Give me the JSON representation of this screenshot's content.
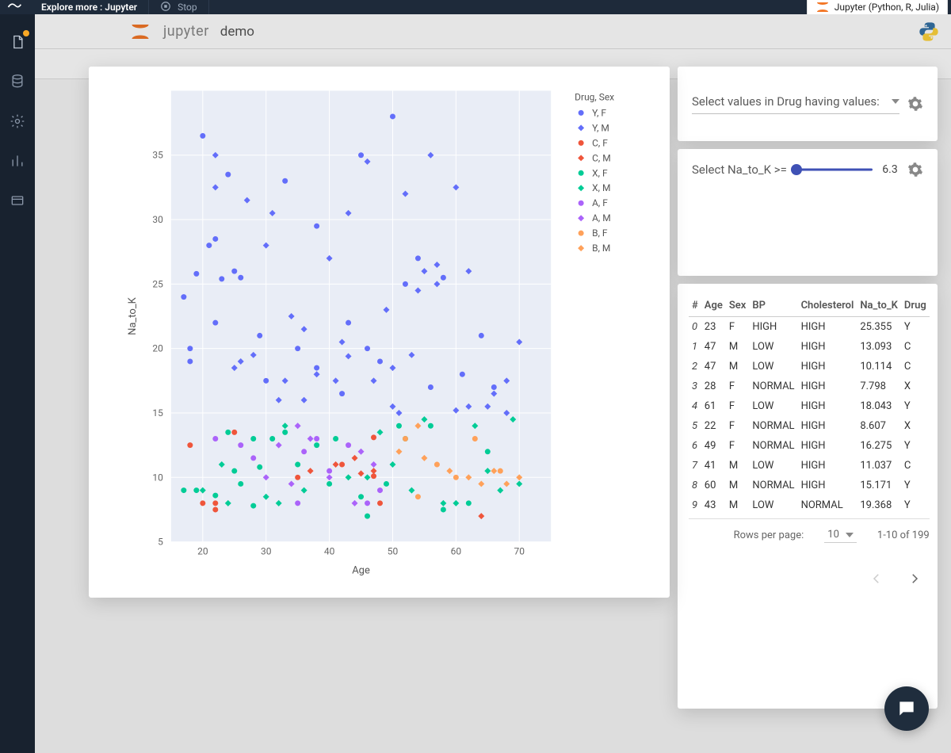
{
  "topbar": {
    "brand": "cnvrg",
    "tab_label": "Explore more : Jupyter",
    "stop_label": "Stop",
    "kernel_label": "Jupyter (Python, R, Julia)"
  },
  "sidebar_items": [
    "projects",
    "database",
    "settings",
    "analytics",
    "docs"
  ],
  "notebook": {
    "logo_text": "jupyter",
    "title": "demo"
  },
  "filter": {
    "label": "Select values in Drug having values:"
  },
  "slider": {
    "label": "Select Na_to_K >=",
    "value": "6.3",
    "min": 6.3,
    "max": 38.2,
    "pos_pct": 0
  },
  "table": {
    "columns": [
      "#",
      "Age",
      "Sex",
      "BP",
      "Cholesterol",
      "Na_to_K",
      "Drug"
    ],
    "rows": [
      {
        "i": "0",
        "Age": "23",
        "Sex": "F",
        "BP": "HIGH",
        "Chol": "HIGH",
        "Na": "25.355",
        "Drug": "Y"
      },
      {
        "i": "1",
        "Age": "47",
        "Sex": "M",
        "BP": "LOW",
        "Chol": "HIGH",
        "Na": "13.093",
        "Drug": "C"
      },
      {
        "i": "2",
        "Age": "47",
        "Sex": "M",
        "BP": "LOW",
        "Chol": "HIGH",
        "Na": "10.114",
        "Drug": "C"
      },
      {
        "i": "3",
        "Age": "28",
        "Sex": "F",
        "BP": "NORMAL",
        "Chol": "HIGH",
        "Na": "7.798",
        "Drug": "X"
      },
      {
        "i": "4",
        "Age": "61",
        "Sex": "F",
        "BP": "LOW",
        "Chol": "HIGH",
        "Na": "18.043",
        "Drug": "Y"
      },
      {
        "i": "5",
        "Age": "22",
        "Sex": "F",
        "BP": "NORMAL",
        "Chol": "HIGH",
        "Na": "8.607",
        "Drug": "X"
      },
      {
        "i": "6",
        "Age": "49",
        "Sex": "F",
        "BP": "NORMAL",
        "Chol": "HIGH",
        "Na": "16.275",
        "Drug": "Y"
      },
      {
        "i": "7",
        "Age": "41",
        "Sex": "M",
        "BP": "LOW",
        "Chol": "HIGH",
        "Na": "11.037",
        "Drug": "C"
      },
      {
        "i": "8",
        "Age": "60",
        "Sex": "M",
        "BP": "NORMAL",
        "Chol": "HIGH",
        "Na": "15.171",
        "Drug": "Y"
      },
      {
        "i": "9",
        "Age": "43",
        "Sex": "M",
        "BP": "LOW",
        "Chol": "NORMAL",
        "Na": "19.368",
        "Drug": "Y"
      }
    ],
    "rows_per_page_label": "Rows per page:",
    "rows_per_page": "10",
    "page_display": "1-10 of 199"
  },
  "chart_data": {
    "type": "scatter",
    "xlabel": "Age",
    "ylabel": "Na_to_K",
    "xlim": [
      15,
      75
    ],
    "ylim": [
      5,
      40
    ],
    "xticks": [
      20,
      30,
      40,
      50,
      60,
      70
    ],
    "yticks": [
      5,
      10,
      15,
      20,
      25,
      30,
      35
    ],
    "legend_title": "Drug, Sex",
    "legend": [
      {
        "label": "Y, F",
        "color": "#636efa",
        "shape": "circle"
      },
      {
        "label": "Y, M",
        "color": "#636efa",
        "shape": "diamond"
      },
      {
        "label": "C, F",
        "color": "#ef553b",
        "shape": "circle"
      },
      {
        "label": "C, M",
        "color": "#ef553b",
        "shape": "diamond"
      },
      {
        "label": "X, F",
        "color": "#00cc96",
        "shape": "circle"
      },
      {
        "label": "X, M",
        "color": "#00cc96",
        "shape": "diamond"
      },
      {
        "label": "A, F",
        "color": "#ab63fa",
        "shape": "circle"
      },
      {
        "label": "A, M",
        "color": "#ab63fa",
        "shape": "diamond"
      },
      {
        "label": "B, F",
        "color": "#ffa15a",
        "shape": "circle"
      },
      {
        "label": "B, M",
        "color": "#ffa15a",
        "shape": "diamond"
      }
    ],
    "series": [
      {
        "name": "Y, F",
        "color": "#636efa",
        "shape": "circle",
        "points": [
          [
            23,
            25.4
          ],
          [
            20,
            36.5
          ],
          [
            17,
            24.0
          ],
          [
            18,
            20.0
          ],
          [
            18,
            19.0
          ],
          [
            21,
            28.0
          ],
          [
            22,
            28.5
          ],
          [
            19,
            25.8
          ],
          [
            24,
            33.5
          ],
          [
            25,
            26.0
          ],
          [
            26,
            25.5
          ],
          [
            22,
            22.0
          ],
          [
            29,
            21.0
          ],
          [
            35,
            20.0
          ],
          [
            30,
            17.5
          ],
          [
            33,
            33.0
          ],
          [
            38,
            18.5
          ],
          [
            38,
            29.5
          ],
          [
            43,
            22.0
          ],
          [
            42,
            16.5
          ],
          [
            46,
            20.0
          ],
          [
            48,
            19.0
          ],
          [
            50,
            38.0
          ],
          [
            52,
            25.0
          ],
          [
            54,
            27.0
          ],
          [
            56,
            17.0
          ],
          [
            58,
            25.5
          ],
          [
            61,
            18.0
          ],
          [
            64,
            21.0
          ],
          [
            66,
            17.0
          ],
          [
            45,
            35.0
          ]
        ]
      },
      {
        "name": "Y, M",
        "color": "#636efa",
        "shape": "diamond",
        "points": [
          [
            22,
            35.0
          ],
          [
            22,
            32.5
          ],
          [
            25,
            18.5
          ],
          [
            26,
            19.0
          ],
          [
            28,
            19.5
          ],
          [
            27,
            31.5
          ],
          [
            30,
            28.0
          ],
          [
            31,
            30.5
          ],
          [
            32,
            16.0
          ],
          [
            33,
            17.5
          ],
          [
            34,
            22.5
          ],
          [
            36,
            16.0
          ],
          [
            36,
            21.5
          ],
          [
            38,
            18.0
          ],
          [
            40,
            27.0
          ],
          [
            41,
            17.5
          ],
          [
            42,
            20.5
          ],
          [
            43,
            19.4
          ],
          [
            43,
            30.5
          ],
          [
            46,
            34.5
          ],
          [
            47,
            17.5
          ],
          [
            49,
            23.0
          ],
          [
            50,
            15.5
          ],
          [
            50,
            18.5
          ],
          [
            52,
            32.0
          ],
          [
            54,
            24.5
          ],
          [
            55,
            26.0
          ],
          [
            56,
            35.0
          ],
          [
            57,
            26.5
          ],
          [
            60,
            15.2
          ],
          [
            62,
            26.0
          ],
          [
            62,
            15.5
          ],
          [
            65,
            15.5
          ],
          [
            66,
            16.5
          ],
          [
            68,
            17.5
          ],
          [
            70,
            20.5
          ],
          [
            60,
            32.5
          ],
          [
            68,
            15.0
          ],
          [
            51,
            15.0
          ],
          [
            53,
            19.5
          ],
          [
            57,
            25.0
          ]
        ]
      },
      {
        "name": "C, F",
        "color": "#ef553b",
        "shape": "circle",
        "points": [
          [
            18,
            12.5
          ],
          [
            25,
            13.5
          ],
          [
            20,
            8.0
          ],
          [
            22,
            8.0
          ],
          [
            22,
            7.5
          ],
          [
            35,
            10.0
          ],
          [
            42,
            11.0
          ],
          [
            47,
            13.1
          ],
          [
            47,
            10.1
          ],
          [
            48,
            8.0
          ]
        ]
      },
      {
        "name": "C, M",
        "color": "#ef553b",
        "shape": "diamond",
        "points": [
          [
            37,
            10.5
          ],
          [
            41,
            11.0
          ],
          [
            44,
            11.5
          ],
          [
            45,
            10.3
          ],
          [
            47,
            10.5
          ],
          [
            64,
            7.0
          ]
        ]
      },
      {
        "name": "X, F",
        "color": "#00cc96",
        "shape": "circle",
        "points": [
          [
            17,
            9.0
          ],
          [
            19,
            9.0
          ],
          [
            22,
            8.6
          ],
          [
            24,
            13.5
          ],
          [
            25,
            10.5
          ],
          [
            26,
            9.5
          ],
          [
            28,
            7.8
          ],
          [
            29,
            10.8
          ],
          [
            31,
            13.0
          ],
          [
            33,
            13.5
          ],
          [
            35,
            11.0
          ],
          [
            38,
            12.5
          ],
          [
            40,
            9.5
          ],
          [
            41,
            13.0
          ],
          [
            45,
            8.5
          ],
          [
            49,
            9.5
          ],
          [
            51,
            14.0
          ],
          [
            52,
            13.0
          ],
          [
            56,
            14.0
          ],
          [
            58,
            7.5
          ],
          [
            62,
            8.0
          ],
          [
            65,
            12.0
          ],
          [
            46,
            7.0
          ],
          [
            28,
            13.0
          ]
        ]
      },
      {
        "name": "X, M",
        "color": "#00cc96",
        "shape": "diamond",
        "points": [
          [
            20,
            9.0
          ],
          [
            23,
            11.0
          ],
          [
            24,
            8.0
          ],
          [
            30,
            8.5
          ],
          [
            32,
            8.0
          ],
          [
            33,
            14.0
          ],
          [
            36,
            9.0
          ],
          [
            43,
            10.0
          ],
          [
            46,
            10.0
          ],
          [
            48,
            13.5
          ],
          [
            50,
            11.0
          ],
          [
            53,
            9.0
          ],
          [
            55,
            14.5
          ],
          [
            58,
            8.0
          ],
          [
            60,
            8.0
          ],
          [
            63,
            14.0
          ],
          [
            65,
            10.5
          ],
          [
            67,
            9.0
          ],
          [
            69,
            14.5
          ],
          [
            70,
            9.5
          ]
        ]
      },
      {
        "name": "A, F",
        "color": "#ab63fa",
        "shape": "circle",
        "points": [
          [
            22,
            13.0
          ],
          [
            26,
            12.5
          ],
          [
            28,
            11.5
          ],
          [
            36,
            12.0
          ],
          [
            38,
            13.0
          ],
          [
            40,
            10.5
          ],
          [
            43,
            12.5
          ],
          [
            46,
            8.0
          ],
          [
            48,
            9.0
          ],
          [
            35,
            8.0
          ]
        ]
      },
      {
        "name": "A, M",
        "color": "#ab63fa",
        "shape": "diamond",
        "points": [
          [
            30,
            10.0
          ],
          [
            32,
            12.5
          ],
          [
            34,
            9.5
          ],
          [
            35,
            14.0
          ],
          [
            37,
            13.0
          ],
          [
            40,
            10.0
          ],
          [
            44,
            8.0
          ],
          [
            45,
            12.0
          ],
          [
            47,
            11.0
          ]
        ]
      },
      {
        "name": "B, F",
        "color": "#ffa15a",
        "shape": "circle",
        "points": [
          [
            52,
            13.0
          ],
          [
            54,
            8.5
          ],
          [
            57,
            11.0
          ],
          [
            60,
            10.0
          ],
          [
            63,
            13.0
          ],
          [
            67,
            10.5
          ]
        ]
      },
      {
        "name": "B, M",
        "color": "#ffa15a",
        "shape": "diamond",
        "points": [
          [
            51,
            12.0
          ],
          [
            54,
            14.0
          ],
          [
            55,
            11.5
          ],
          [
            59,
            10.5
          ],
          [
            62,
            10.0
          ],
          [
            64,
            9.5
          ],
          [
            66,
            10.5
          ],
          [
            68,
            9.5
          ],
          [
            70,
            10.0
          ]
        ]
      }
    ]
  }
}
